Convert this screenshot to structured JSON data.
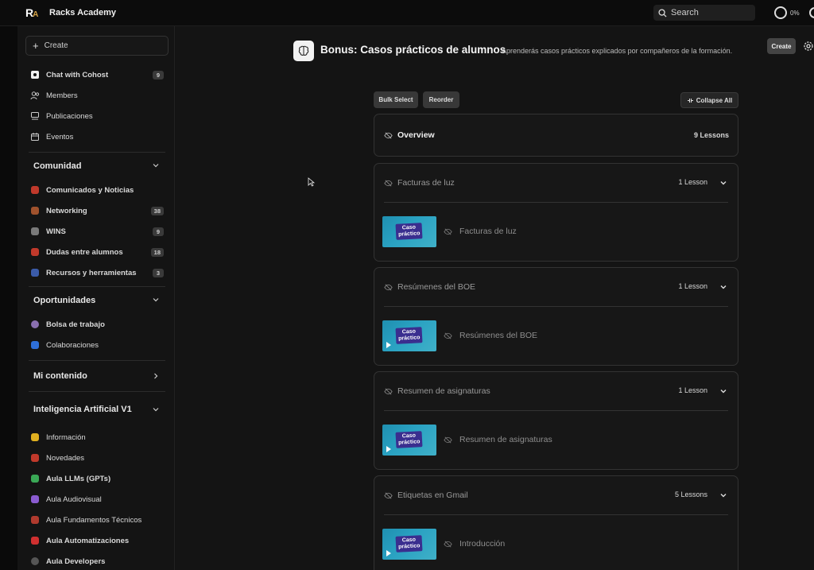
{
  "app": {
    "logo_r": "R",
    "logo_a": "A",
    "name": "Racks Academy",
    "search_label": "Search",
    "progress": "0%"
  },
  "sidebar": {
    "create_label": "Create",
    "primary": [
      {
        "label": "Chat with Cohost",
        "badge": "9",
        "icon": "chat-icon"
      },
      {
        "label": "Members",
        "badge": "",
        "icon": "members-icon"
      },
      {
        "label": "Publicaciones",
        "badge": "",
        "icon": "posts-icon"
      },
      {
        "label": "Eventos",
        "badge": "",
        "icon": "calendar-icon"
      }
    ],
    "sections": [
      {
        "title": "Comunidad",
        "expanded": true,
        "items": [
          {
            "label": "Comunicados y Noticias",
            "badge": "",
            "color": "#c0392b"
          },
          {
            "label": "Networking",
            "badge": "38",
            "color": "#a0522d"
          },
          {
            "label": "WINS",
            "badge": "9",
            "color": "#7a7a7a"
          },
          {
            "label": "Dudas entre alumnos",
            "badge": "18",
            "color": "#c0392b"
          },
          {
            "label": "Recursos y herramientas",
            "badge": "3",
            "color": "#3b5ba9"
          }
        ]
      },
      {
        "title": "Oportunidades",
        "expanded": true,
        "items": [
          {
            "label": "Bolsa de trabajo",
            "badge": "",
            "color": "#8a6fb0"
          },
          {
            "label": "Colaboraciones",
            "badge": "",
            "color": "#2e6fd8"
          }
        ]
      },
      {
        "title": "Mi contenido",
        "expanded": false,
        "items": []
      },
      {
        "title": "Inteligencia Artificial V1",
        "expanded": true,
        "items": [
          {
            "label": "Información",
            "badge": "",
            "color": "#e0b020",
            "bold": false
          },
          {
            "label": "Novedades",
            "badge": "",
            "color": "#c0392b",
            "bold": false
          },
          {
            "label": "Aula LLMs (GPTs)",
            "badge": "",
            "color": "#3aa856",
            "bold": true
          },
          {
            "label": "Aula Audiovisual",
            "badge": "",
            "color": "#8a5bd0",
            "bold": false
          },
          {
            "label": "Aula Fundamentos Técnicos",
            "badge": "",
            "color": "#b03a2e",
            "bold": false
          },
          {
            "label": "Aula Automatizaciones",
            "badge": "",
            "color": "#d03030",
            "bold": true
          },
          {
            "label": "Aula Developers",
            "badge": "",
            "color": "#555555",
            "bold": true
          }
        ]
      }
    ]
  },
  "main": {
    "title": "Bonus: Casos prácticos de alumnos",
    "subtitle": "· Aprenderás casos prácticos explicados por compañeros de la formación.",
    "create_label": "Create",
    "bulk_select": "Bulk Select",
    "reorder": "Reorder",
    "collapse_all": "Collapse All",
    "thumb_label_1": "Caso",
    "thumb_label_2": "práctico",
    "overview": {
      "title": "Overview",
      "lessons": "9 Lessons"
    },
    "modules": [
      {
        "title": "Facturas de luz",
        "lessons": "1 Lesson",
        "lesson": "Facturas de luz",
        "play": false
      },
      {
        "title": "Resúmenes del BOE",
        "lessons": "1 Lesson",
        "lesson": "Resúmenes del BOE",
        "play": true
      },
      {
        "title": "Resumen de asignaturas",
        "lessons": "1 Lesson",
        "lesson": "Resumen de asignaturas",
        "play": true
      },
      {
        "title": "Etiquetas en Gmail",
        "lessons": "5 Lessons",
        "lesson": "Introducción",
        "play": true
      }
    ]
  }
}
